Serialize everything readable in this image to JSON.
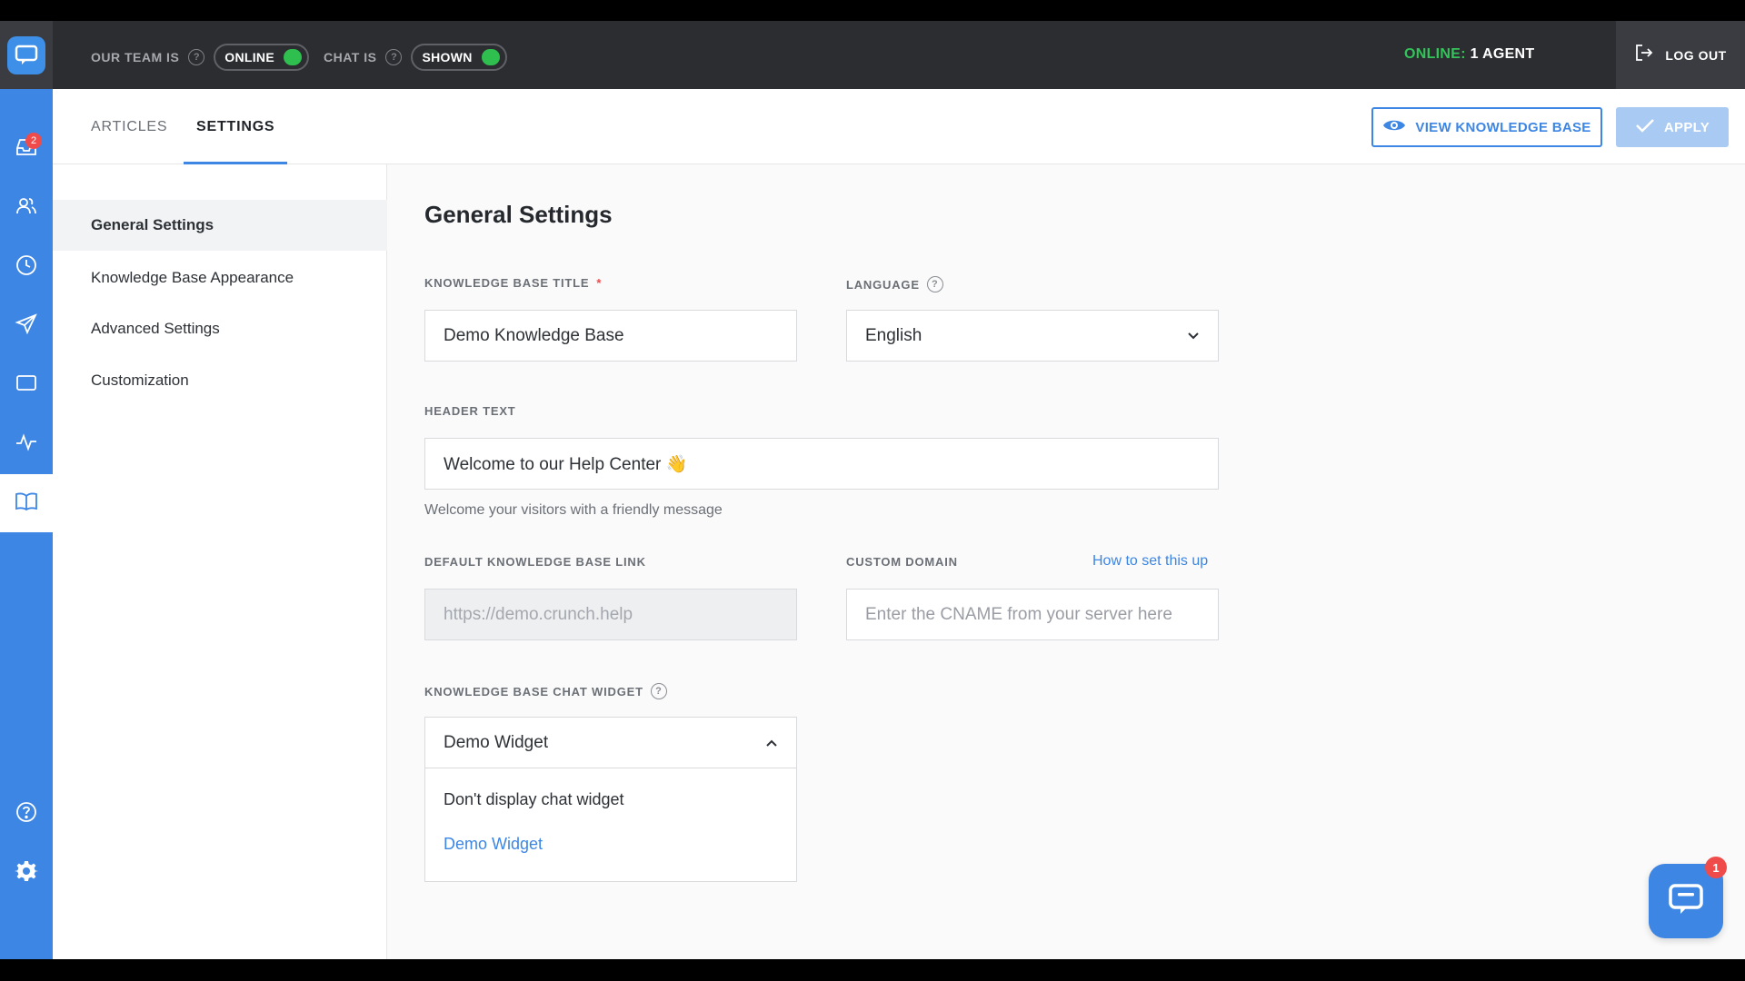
{
  "topbar": {
    "team_label": "OUR TEAM IS",
    "team_status": "ONLINE",
    "chat_label": "CHAT IS",
    "chat_status": "SHOWN",
    "online_label": "ONLINE:",
    "online_value": "1 AGENT",
    "logout_label": "LOG OUT",
    "help_glyph": "?"
  },
  "leftnav": {
    "inbox_badge": "2",
    "items": [
      {
        "icon": "inbox-icon"
      },
      {
        "icon": "users-icon"
      },
      {
        "icon": "clock-icon"
      },
      {
        "icon": "send-icon"
      },
      {
        "icon": "monitor-icon"
      },
      {
        "icon": "activity-icon"
      },
      {
        "icon": "book-icon",
        "active": true
      },
      {
        "icon": "help-icon"
      },
      {
        "icon": "gear-icon"
      }
    ]
  },
  "tabs": [
    {
      "label": "ARTICLES"
    },
    {
      "label": "SETTINGS",
      "active": true
    }
  ],
  "actions": {
    "view_kb_label": "VIEW KNOWLEDGE BASE",
    "apply_label": "APPLY"
  },
  "sidebar": {
    "items": [
      {
        "label": "General Settings",
        "active": true
      },
      {
        "label": "Knowledge Base Appearance"
      },
      {
        "label": "Advanced Settings"
      },
      {
        "label": "Customization"
      }
    ]
  },
  "form": {
    "page_title": "General Settings",
    "kb_title": {
      "label": "KNOWLEDGE BASE TITLE",
      "required_mark": "*",
      "value": "Demo Knowledge Base"
    },
    "language": {
      "label": "LANGUAGE",
      "value": "English"
    },
    "header_text": {
      "label": "HEADER TEXT",
      "value": "Welcome to our Help Center 👋",
      "hint": "Welcome your visitors with a friendly message"
    },
    "default_link": {
      "label": "DEFAULT KNOWLEDGE BASE LINK",
      "placeholder": "https://demo.crunch.help"
    },
    "custom_domain": {
      "label": "CUSTOM DOMAIN",
      "help_link": "How to set this up",
      "placeholder": "Enter the CNAME from your server here"
    },
    "chat_widget": {
      "label": "KNOWLEDGE BASE CHAT WIDGET",
      "value": "Demo Widget",
      "options": [
        "Don't display chat widget",
        "Demo Widget"
      ]
    }
  },
  "chat_fab": {
    "badge": "1"
  },
  "colors": {
    "accent": "#3d86e4",
    "online_green": "#33c35a",
    "badge_red": "#ef4b4b",
    "topbar": "#2b2d31"
  }
}
